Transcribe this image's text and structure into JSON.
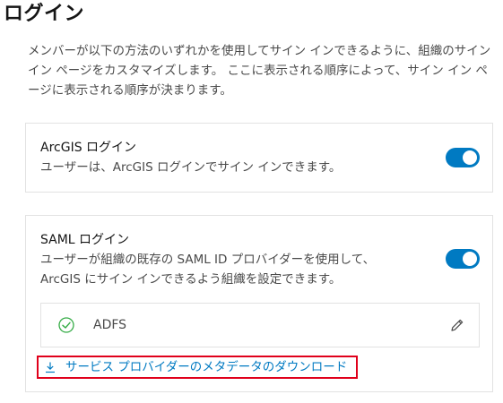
{
  "page": {
    "title": "ログイン",
    "intro": "メンバーが以下の方法のいずれかを使用してサイン インできるように、組織のサイン イン ページをカスタマイズします。 ここに表示される順序によって、サイン イン ページに表示される順序が決まります。"
  },
  "arcgis_login": {
    "title": "ArcGIS ログイン",
    "description": "ユーザーは、ArcGIS ログインでサイン インできます。",
    "enabled": true
  },
  "saml_login": {
    "title": "SAML ログイン",
    "description_line1": "ユーザーが組織の既存の SAML ID プロバイダーを使用して、",
    "description_line2": "ArcGIS にサイン インできるよう組織を設定できます。",
    "enabled": true,
    "identity_provider": {
      "name": "ADFS",
      "status_icon": "check-circle-icon",
      "edit_icon": "pencil-icon"
    },
    "download_link": "サービス プロバイダーのメタデータのダウンロード",
    "download_icon": "download-icon"
  },
  "colors": {
    "accent": "#007ac2",
    "highlight_border": "#e0001b",
    "text": "#151515",
    "secondary_text": "#4a4a4a",
    "card_border": "#e2e2e2",
    "success": "#35ac46"
  }
}
